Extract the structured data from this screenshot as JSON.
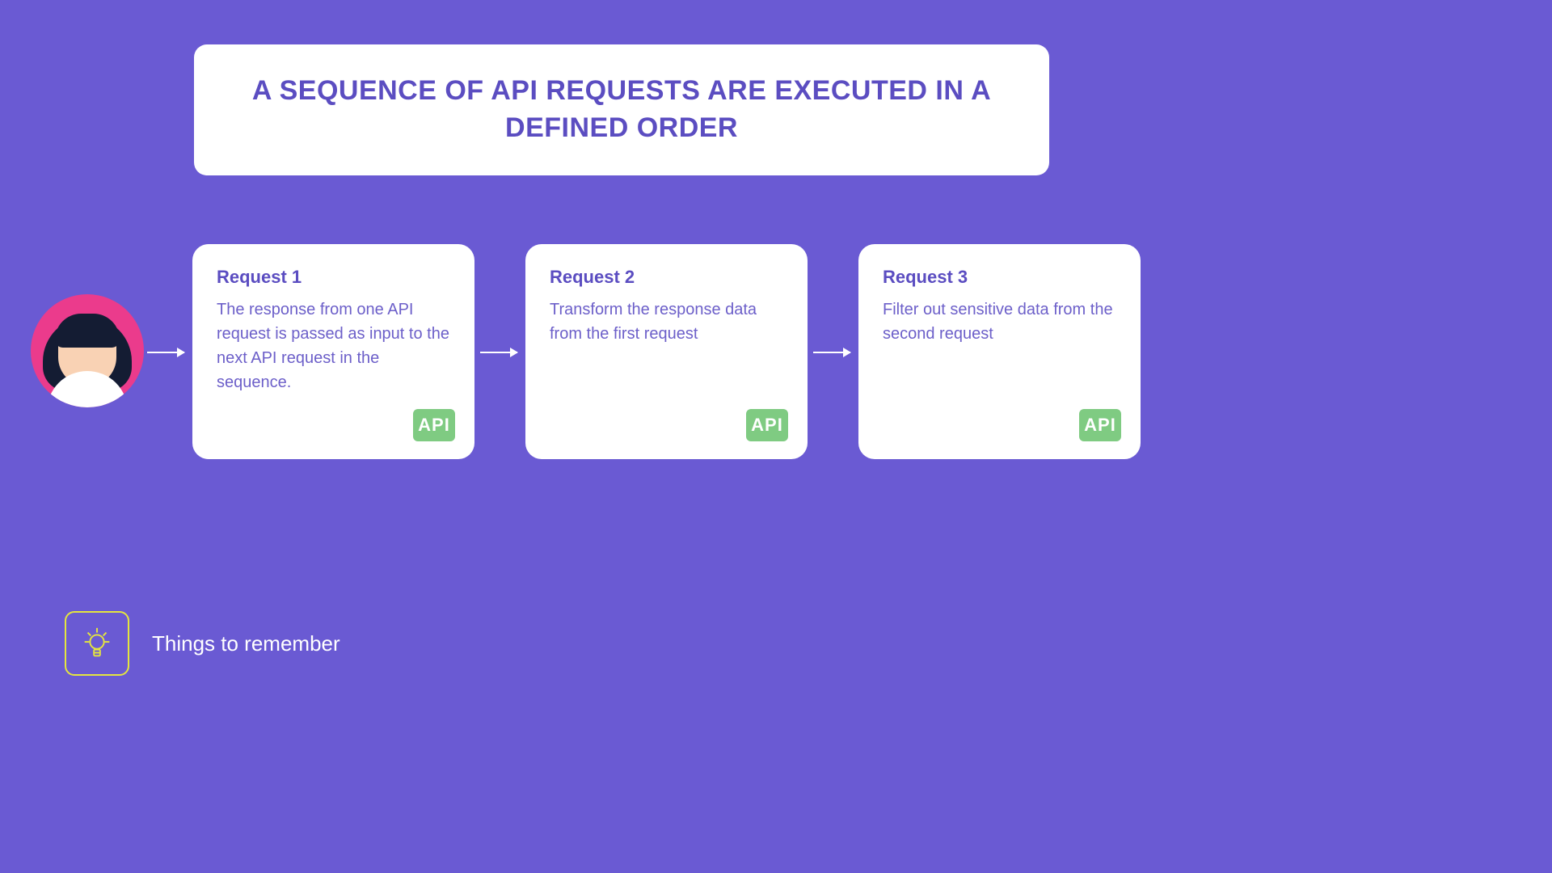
{
  "title": "A SEQUENCE OF API REQUESTS ARE EXECUTED IN A DEFINED ORDER",
  "cards": [
    {
      "title": "Request 1",
      "text": "The response from one API request is passed as input to the next API request in the sequence.",
      "badge": "API"
    },
    {
      "title": "Request 2",
      "text": "Transform the response data from the first request",
      "badge": "API"
    },
    {
      "title": "Request 3",
      "text": "Filter out sensitive data from the second request",
      "badge": "API"
    }
  ],
  "footer": {
    "label": "Things to remember"
  },
  "colors": {
    "bg": "#6A5AD3",
    "accent": "#5B4DC1",
    "badge": "#7FCB82",
    "highlight": "#E5E63E",
    "avatar_bg": "#EB3B8C"
  }
}
